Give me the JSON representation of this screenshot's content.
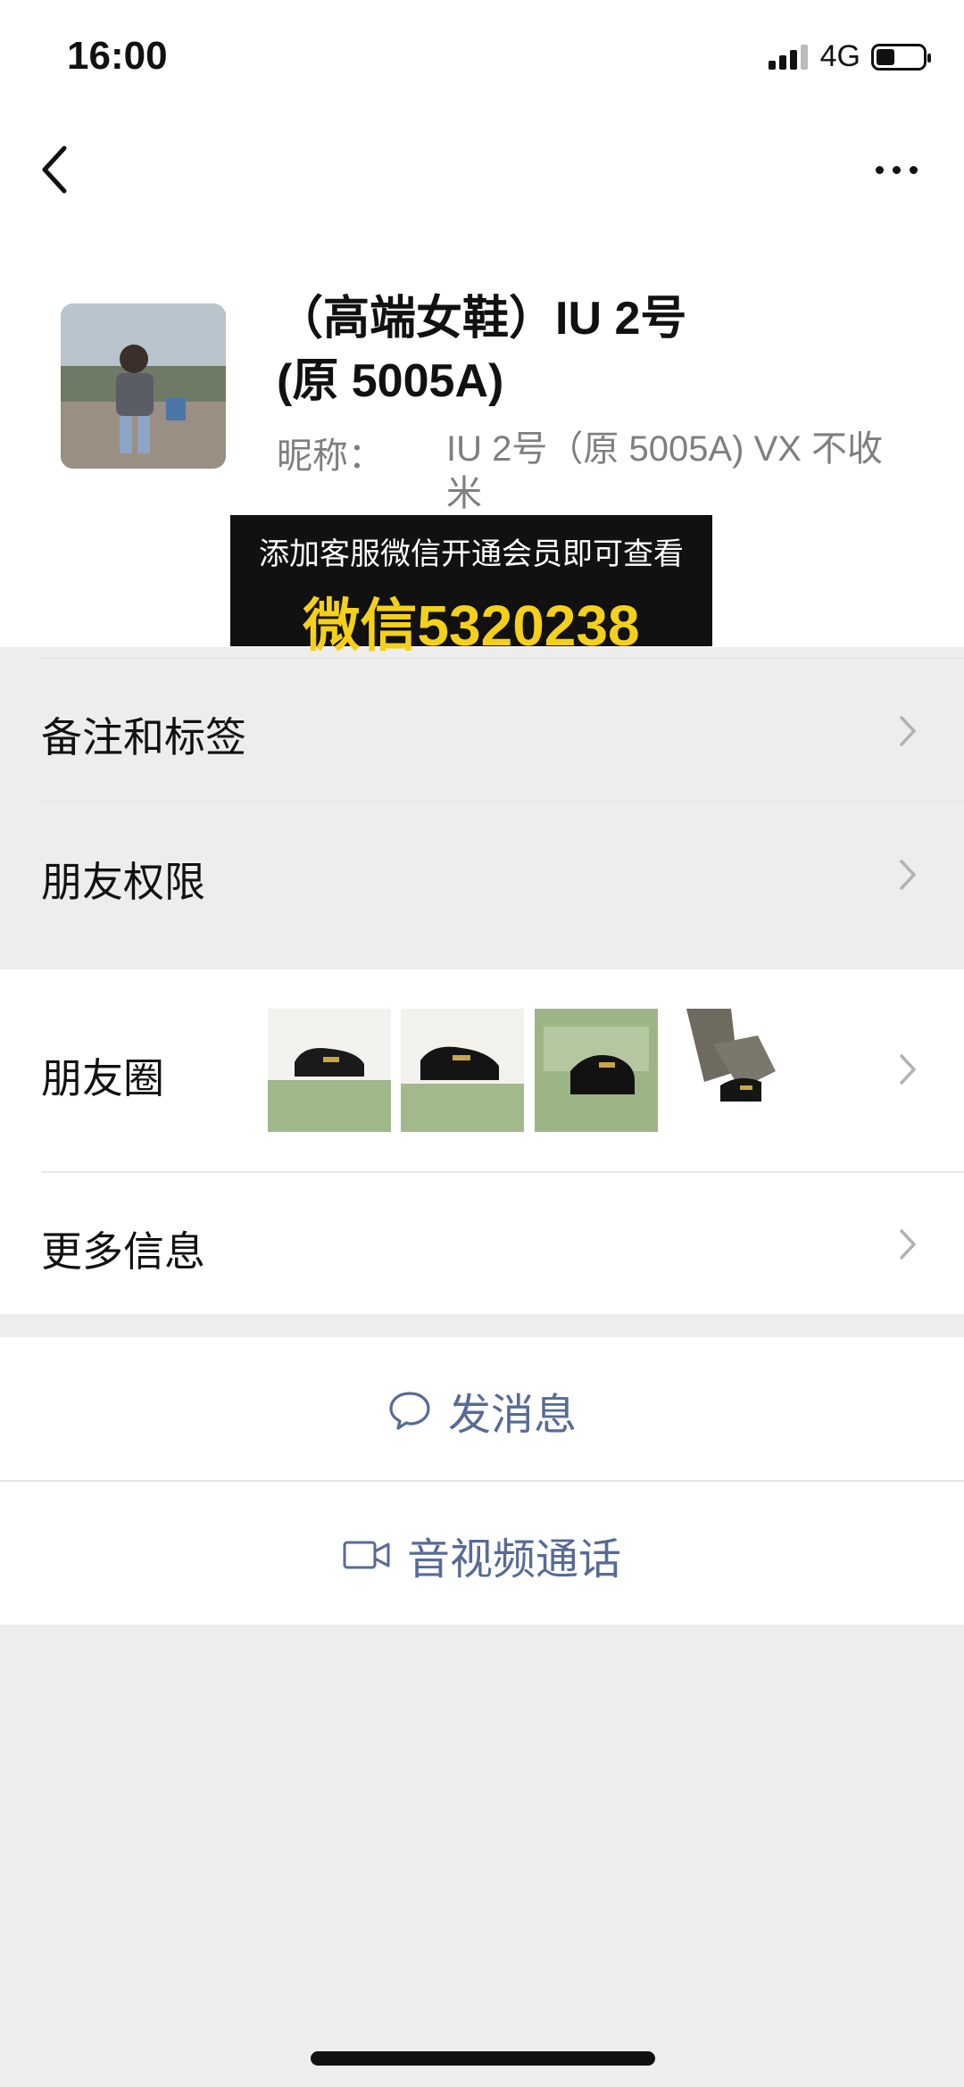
{
  "status_bar": {
    "time": "16:00",
    "network": "4G"
  },
  "profile": {
    "name_line1": "（高端女鞋）IU 2号",
    "name_line2": "(原 5005A)",
    "nickname_label": "昵称：",
    "nickname_value": "IU 2号（原 5005A) VX 不收米"
  },
  "banner": {
    "line1": "添加客服微信开通会员即可查看",
    "line2": "微信5320238"
  },
  "menu": {
    "notes_tags": "备注和标签",
    "permissions": "朋友权限",
    "moments": "朋友圈",
    "more_info": "更多信息"
  },
  "actions": {
    "send_message": "发消息",
    "av_call": "音视频通话"
  },
  "colors": {
    "link": "#576b95",
    "banner_text": "#f5d01a",
    "background": "#ededed"
  }
}
